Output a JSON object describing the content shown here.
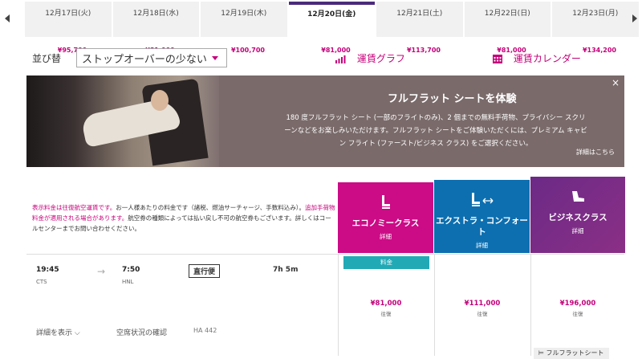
{
  "dates": [
    {
      "date": "12月17日(火)",
      "price": "¥95,700"
    },
    {
      "date": "12月18日(水)",
      "price": "¥81,000"
    },
    {
      "date": "12月19日(木)",
      "price": "¥100,700"
    },
    {
      "date": "12月20日(金)",
      "price": "¥81,000",
      "active": true
    },
    {
      "date": "12月21日(土)",
      "price": "¥113,700"
    },
    {
      "date": "12月22日(日)",
      "price": "¥81,000"
    },
    {
      "date": "12月23日(月)",
      "price": "¥134,200"
    }
  ],
  "sort": {
    "label": "並び替",
    "value": "ストップオーバーの少ない"
  },
  "links": {
    "fare_graph": "運賃グラフ",
    "fare_calendar": "運賃カレンダー"
  },
  "banner": {
    "title": "フルフラット シートを体験",
    "text": "180 度フルフラット シート (一部のフライトのみ)、2 個までの無料手荷物、プライバシー スクリーンなどをお楽しみいただけます。フルフラット シートをご体験いただくには、プレミアム キャビン フライト (ファースト/ビジネス クラス) をご選択ください。",
    "more": "詳細はこちら",
    "close": "×"
  },
  "info": {
    "red1": "表示料金は往復航空運賃です。",
    "text1": "お一人様あたりの料金です（諸税、燃油サーチャージ、手数料込み）。",
    "red2": "追加手荷物料金が適用される場合があります。",
    "text2": "航空券の種類によっては払い戻し不可の航空券もございます。詳しくはコールセンターまでお問い合わせください。"
  },
  "classes": {
    "economy": {
      "name": "エコノミークラス",
      "detail": "詳細",
      "color": "#cc0b86"
    },
    "extra": {
      "name": "エクストラ・コンフォート",
      "detail": "詳細",
      "color": "#0d6fb0"
    },
    "business": {
      "name": "ビジネスクラス",
      "detail": "詳細",
      "color": "#7b2c86"
    }
  },
  "flight": {
    "dep_time": "19:45",
    "dep_code": "CTS",
    "arr_time": "7:50",
    "arr_code": "HNL",
    "nonstop": "直行便",
    "duration": "7h 5m",
    "details": "詳細を表示",
    "seat_check": "空席状況の確認",
    "flight_no": "HA 442",
    "fare_badge": "料金",
    "prices": {
      "economy": "¥81,000",
      "extra": "¥111,000",
      "business": "¥196,000"
    },
    "round_trip": "往復",
    "flat_seat": "フルフラットシート"
  }
}
